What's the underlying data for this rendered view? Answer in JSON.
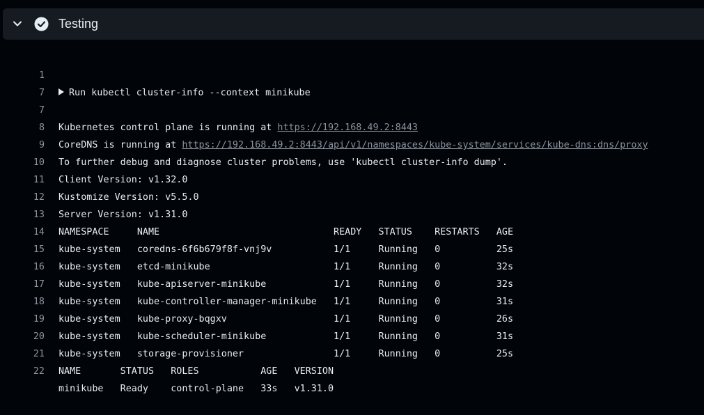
{
  "step": {
    "title": "Testing",
    "status": "success"
  },
  "log": {
    "group_summary": "Run kubectl cluster-info --context minikube",
    "lines": [
      {
        "num": "1"
      },
      {
        "num": "7"
      },
      {
        "num": "7",
        "text": "Kubernetes control plane is running at ",
        "link": "https://192.168.49.2:8443"
      },
      {
        "num": "8",
        "text": "CoreDNS is running at ",
        "link": "https://192.168.49.2:8443/api/v1/namespaces/kube-system/services/kube-dns:dns/proxy"
      },
      {
        "num": "9",
        "text": "To further debug and diagnose cluster problems, use 'kubectl cluster-info dump'."
      },
      {
        "num": "10",
        "text": "Client Version: v1.32.0"
      },
      {
        "num": "11",
        "text": "Kustomize Version: v5.5.0"
      },
      {
        "num": "12",
        "text": "Server Version: v1.31.0"
      },
      {
        "num": "13",
        "text": "NAMESPACE     NAME                               READY   STATUS    RESTARTS   AGE"
      },
      {
        "num": "14",
        "text": "kube-system   coredns-6f6b679f8f-vnj9v           1/1     Running   0          25s"
      },
      {
        "num": "15",
        "text": "kube-system   etcd-minikube                      1/1     Running   0          32s"
      },
      {
        "num": "16",
        "text": "kube-system   kube-apiserver-minikube            1/1     Running   0          32s"
      },
      {
        "num": "17",
        "text": "kube-system   kube-controller-manager-minikube   1/1     Running   0          31s"
      },
      {
        "num": "18",
        "text": "kube-system   kube-proxy-bqgxv                   1/1     Running   0          26s"
      },
      {
        "num": "19",
        "text": "kube-system   kube-scheduler-minikube            1/1     Running   0          31s"
      },
      {
        "num": "20",
        "text": "kube-system   storage-provisioner                1/1     Running   0          25s"
      },
      {
        "num": "21",
        "text": "NAME       STATUS   ROLES           AGE   VERSION"
      },
      {
        "num": "22",
        "text": "minikube   Ready    control-plane   33s   v1.31.0"
      }
    ]
  }
}
